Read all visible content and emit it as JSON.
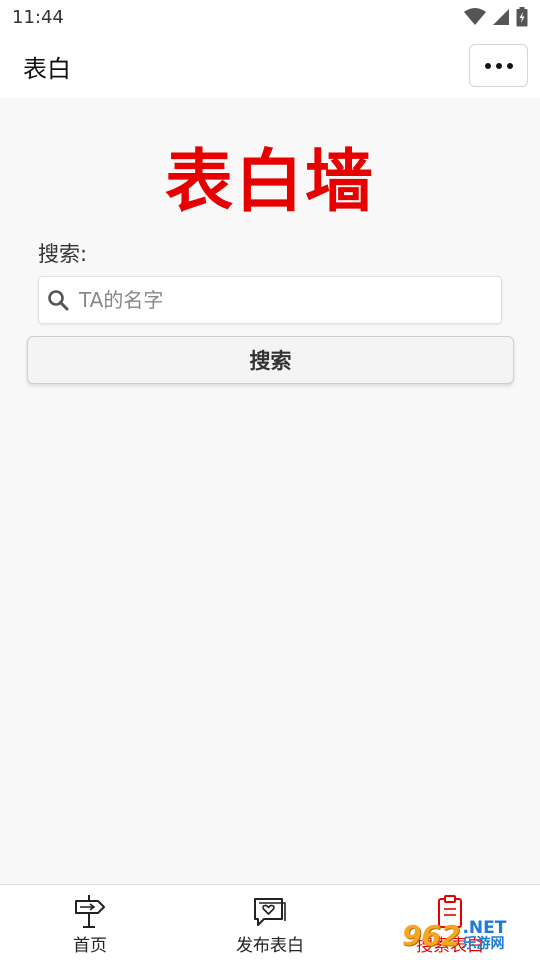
{
  "status_bar": {
    "time": "11:44",
    "icons": [
      "wifi-icon",
      "cellular-signal-icon",
      "battery-icon"
    ]
  },
  "nav_bar": {
    "title": "表白",
    "menu_icon": "more-dots-icon"
  },
  "main": {
    "title": "表白墙",
    "title_color": "#e60000",
    "search_label": "搜索:",
    "search_placeholder": "TA的名字",
    "search_value": "",
    "search_button_label": "搜索"
  },
  "tab_bar": {
    "items": [
      {
        "label": "首页",
        "icon": "signpost-icon",
        "active": false
      },
      {
        "label": "发布表白",
        "icon": "heart-chat-icon",
        "active": false
      },
      {
        "label": "搜索表白",
        "icon": "clipboard-icon",
        "active": true
      }
    ]
  },
  "colors": {
    "accent": "#e60000",
    "background": "#f8f8f8"
  },
  "watermark": {
    "logo": "962",
    "net": ".NET",
    "sub": "乐游网"
  }
}
